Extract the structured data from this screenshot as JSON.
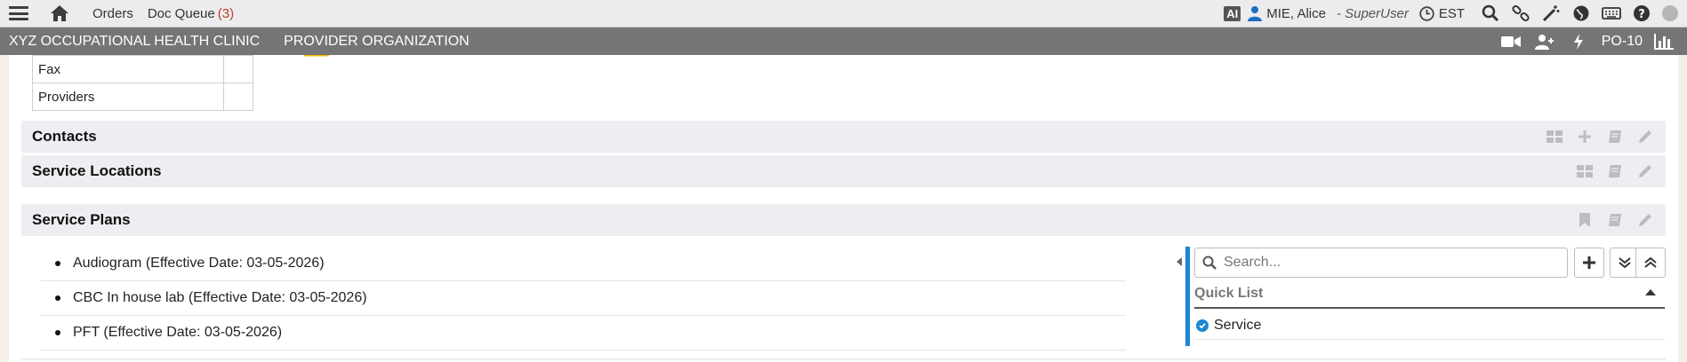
{
  "topbar": {
    "menu_icon": "hamburger-menu-icon",
    "home_icon": "home-icon",
    "orders_label": "Orders",
    "doc_queue_label": "Doc Queue",
    "doc_queue_count": "(3)",
    "ai_badge": "AI",
    "user_name": "MIE, Alice",
    "user_role": "- SuperUser",
    "timezone": "EST",
    "right_icons": [
      "search-icon",
      "link-icon",
      "magic-wand-icon",
      "globe-icon",
      "keyboard-icon",
      "help-icon",
      "status-dot-icon"
    ]
  },
  "orgbar": {
    "clinic_name": "XYZ OCCUPATIONAL HEALTH CLINIC",
    "organization_label": "PROVIDER ORGANIZATION",
    "code": "PO-10",
    "background": "#757575"
  },
  "info_table": {
    "rows": [
      {
        "label": "Fax",
        "value": ""
      },
      {
        "label": "Providers",
        "value": ""
      }
    ]
  },
  "sections": {
    "contacts": {
      "title": "Contacts"
    },
    "service_locations": {
      "title": "Service Locations"
    },
    "service_plans": {
      "title": "Service Plans"
    }
  },
  "service_plans": {
    "items": [
      "Audiogram (Effective Date: 03-05-2026)",
      "CBC In house lab (Effective Date: 03-05-2026)",
      "PFT (Effective Date: 03-05-2026)"
    ]
  },
  "quick_panel": {
    "search_placeholder": "Search...",
    "quick_list_title": "Quick List",
    "items": [
      "Service"
    ],
    "accent": "#1a88d2"
  }
}
